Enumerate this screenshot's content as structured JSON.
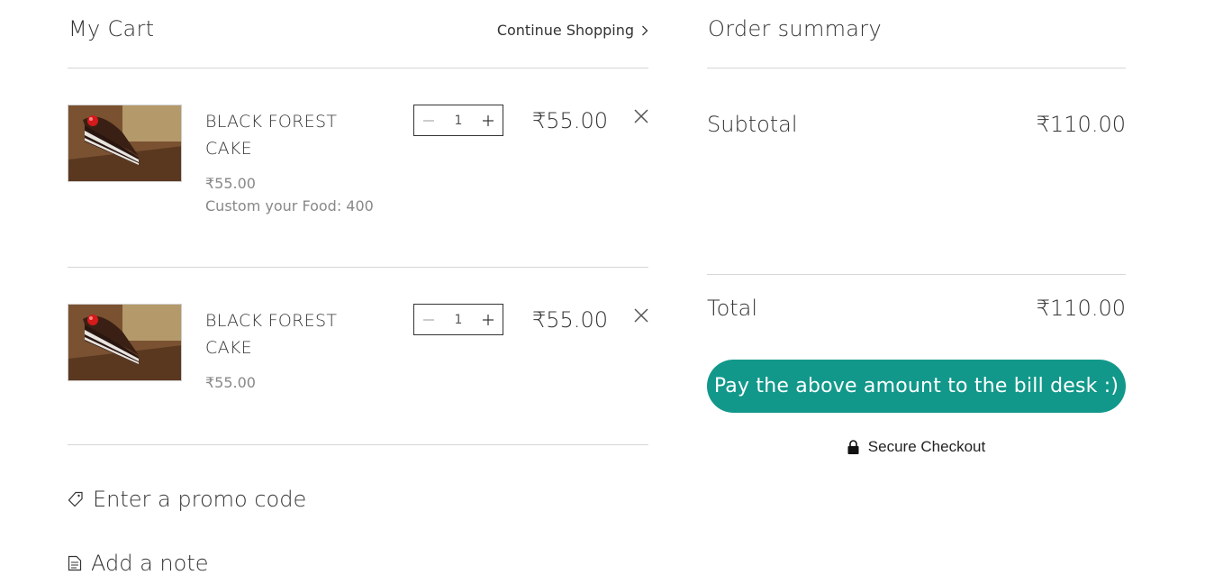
{
  "cart": {
    "title": "My Cart",
    "continue_label": "Continue Shopping",
    "items": [
      {
        "name": "BLACK FOREST CAKE",
        "unit_price": "₹55.00",
        "custom_note": "Custom your Food: 400",
        "quantity": "1",
        "line_total": "₹55.00"
      },
      {
        "name": "BLACK FOREST CAKE",
        "unit_price": "₹55.00",
        "custom_note": "",
        "quantity": "1",
        "line_total": "₹55.00"
      }
    ],
    "promo_label": "Enter a promo code",
    "note_label": "Add a note"
  },
  "summary": {
    "title": "Order summary",
    "subtotal_label": "Subtotal",
    "subtotal_value": "₹110.00",
    "total_label": "Total",
    "total_value": "₹110.00",
    "pay_label": "Pay the above amount to the bill desk :)",
    "secure_label": "Secure Checkout"
  },
  "colors": {
    "accent": "#12988a",
    "divider": "#d6d6d6",
    "text": "#333333",
    "muted": "#888888"
  },
  "icons": [
    "chevron-right-icon",
    "minus-icon",
    "plus-icon",
    "close-icon",
    "tag-icon",
    "note-icon",
    "lock-icon"
  ]
}
